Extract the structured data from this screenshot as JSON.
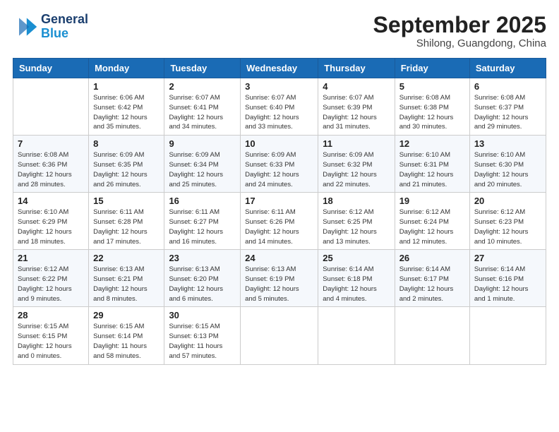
{
  "logo": {
    "line1": "General",
    "line2": "Blue"
  },
  "title": "September 2025",
  "subtitle": "Shilong, Guangdong, China",
  "days_of_week": [
    "Sunday",
    "Monday",
    "Tuesday",
    "Wednesday",
    "Thursday",
    "Friday",
    "Saturday"
  ],
  "weeks": [
    [
      {
        "num": "",
        "info": ""
      },
      {
        "num": "1",
        "info": "Sunrise: 6:06 AM\nSunset: 6:42 PM\nDaylight: 12 hours\nand 35 minutes."
      },
      {
        "num": "2",
        "info": "Sunrise: 6:07 AM\nSunset: 6:41 PM\nDaylight: 12 hours\nand 34 minutes."
      },
      {
        "num": "3",
        "info": "Sunrise: 6:07 AM\nSunset: 6:40 PM\nDaylight: 12 hours\nand 33 minutes."
      },
      {
        "num": "4",
        "info": "Sunrise: 6:07 AM\nSunset: 6:39 PM\nDaylight: 12 hours\nand 31 minutes."
      },
      {
        "num": "5",
        "info": "Sunrise: 6:08 AM\nSunset: 6:38 PM\nDaylight: 12 hours\nand 30 minutes."
      },
      {
        "num": "6",
        "info": "Sunrise: 6:08 AM\nSunset: 6:37 PM\nDaylight: 12 hours\nand 29 minutes."
      }
    ],
    [
      {
        "num": "7",
        "info": "Sunrise: 6:08 AM\nSunset: 6:36 PM\nDaylight: 12 hours\nand 28 minutes."
      },
      {
        "num": "8",
        "info": "Sunrise: 6:09 AM\nSunset: 6:35 PM\nDaylight: 12 hours\nand 26 minutes."
      },
      {
        "num": "9",
        "info": "Sunrise: 6:09 AM\nSunset: 6:34 PM\nDaylight: 12 hours\nand 25 minutes."
      },
      {
        "num": "10",
        "info": "Sunrise: 6:09 AM\nSunset: 6:33 PM\nDaylight: 12 hours\nand 24 minutes."
      },
      {
        "num": "11",
        "info": "Sunrise: 6:09 AM\nSunset: 6:32 PM\nDaylight: 12 hours\nand 22 minutes."
      },
      {
        "num": "12",
        "info": "Sunrise: 6:10 AM\nSunset: 6:31 PM\nDaylight: 12 hours\nand 21 minutes."
      },
      {
        "num": "13",
        "info": "Sunrise: 6:10 AM\nSunset: 6:30 PM\nDaylight: 12 hours\nand 20 minutes."
      }
    ],
    [
      {
        "num": "14",
        "info": "Sunrise: 6:10 AM\nSunset: 6:29 PM\nDaylight: 12 hours\nand 18 minutes."
      },
      {
        "num": "15",
        "info": "Sunrise: 6:11 AM\nSunset: 6:28 PM\nDaylight: 12 hours\nand 17 minutes."
      },
      {
        "num": "16",
        "info": "Sunrise: 6:11 AM\nSunset: 6:27 PM\nDaylight: 12 hours\nand 16 minutes."
      },
      {
        "num": "17",
        "info": "Sunrise: 6:11 AM\nSunset: 6:26 PM\nDaylight: 12 hours\nand 14 minutes."
      },
      {
        "num": "18",
        "info": "Sunrise: 6:12 AM\nSunset: 6:25 PM\nDaylight: 12 hours\nand 13 minutes."
      },
      {
        "num": "19",
        "info": "Sunrise: 6:12 AM\nSunset: 6:24 PM\nDaylight: 12 hours\nand 12 minutes."
      },
      {
        "num": "20",
        "info": "Sunrise: 6:12 AM\nSunset: 6:23 PM\nDaylight: 12 hours\nand 10 minutes."
      }
    ],
    [
      {
        "num": "21",
        "info": "Sunrise: 6:12 AM\nSunset: 6:22 PM\nDaylight: 12 hours\nand 9 minutes."
      },
      {
        "num": "22",
        "info": "Sunrise: 6:13 AM\nSunset: 6:21 PM\nDaylight: 12 hours\nand 8 minutes."
      },
      {
        "num": "23",
        "info": "Sunrise: 6:13 AM\nSunset: 6:20 PM\nDaylight: 12 hours\nand 6 minutes."
      },
      {
        "num": "24",
        "info": "Sunrise: 6:13 AM\nSunset: 6:19 PM\nDaylight: 12 hours\nand 5 minutes."
      },
      {
        "num": "25",
        "info": "Sunrise: 6:14 AM\nSunset: 6:18 PM\nDaylight: 12 hours\nand 4 minutes."
      },
      {
        "num": "26",
        "info": "Sunrise: 6:14 AM\nSunset: 6:17 PM\nDaylight: 12 hours\nand 2 minutes."
      },
      {
        "num": "27",
        "info": "Sunrise: 6:14 AM\nSunset: 6:16 PM\nDaylight: 12 hours\nand 1 minute."
      }
    ],
    [
      {
        "num": "28",
        "info": "Sunrise: 6:15 AM\nSunset: 6:15 PM\nDaylight: 12 hours\nand 0 minutes."
      },
      {
        "num": "29",
        "info": "Sunrise: 6:15 AM\nSunset: 6:14 PM\nDaylight: 11 hours\nand 58 minutes."
      },
      {
        "num": "30",
        "info": "Sunrise: 6:15 AM\nSunset: 6:13 PM\nDaylight: 11 hours\nand 57 minutes."
      },
      {
        "num": "",
        "info": ""
      },
      {
        "num": "",
        "info": ""
      },
      {
        "num": "",
        "info": ""
      },
      {
        "num": "",
        "info": ""
      }
    ]
  ]
}
